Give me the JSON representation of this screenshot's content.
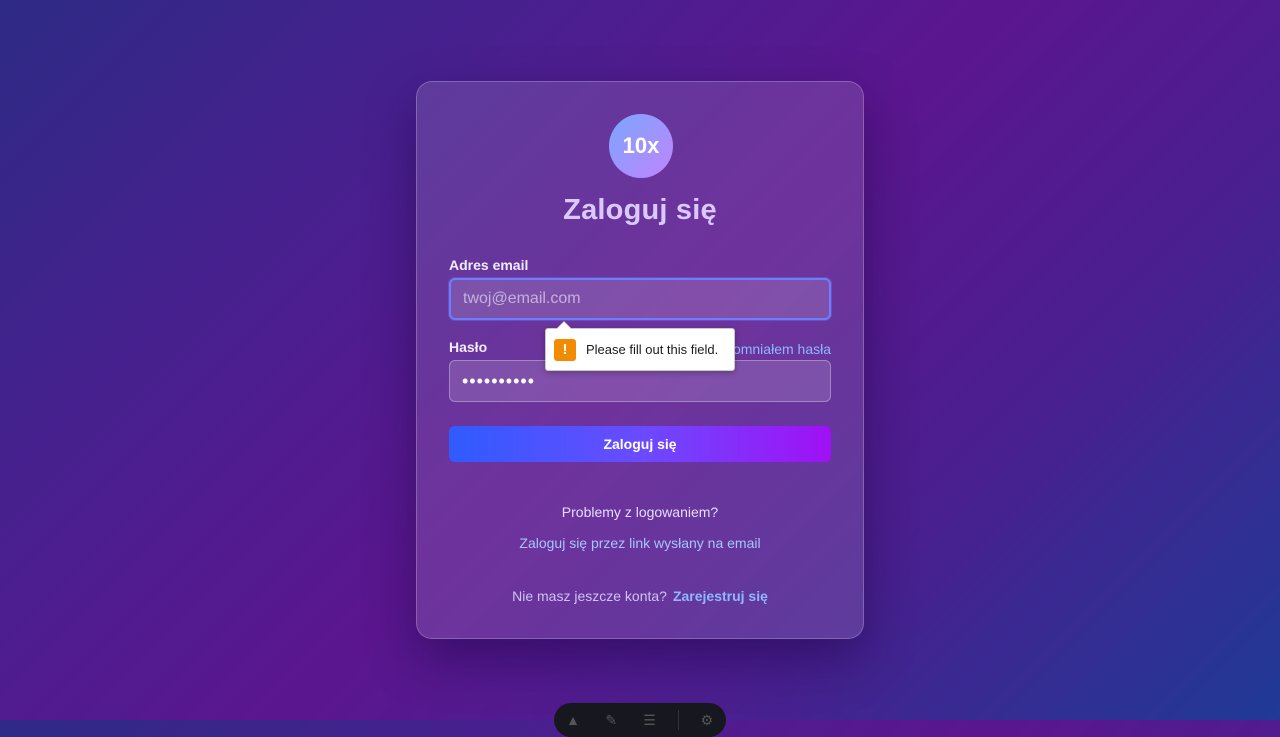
{
  "logo": {
    "text": "10x"
  },
  "heading": "Zaloguj się",
  "email": {
    "label": "Adres email",
    "placeholder": "twoj@email.com",
    "value": ""
  },
  "password": {
    "label": "Hasło",
    "value": "••••••••••",
    "forgot_link": "Zapomniałem hasła"
  },
  "submit_label": "Zaloguj się",
  "problems_text": "Problemy z logowaniem?",
  "magic_link": "Zaloguj się przez link wysłany na email",
  "register": {
    "prompt": "Nie masz jeszcze konta?",
    "link": "Zarejestruj się"
  },
  "validation_tooltip": {
    "icon": "warning-icon",
    "message": "Please fill out this field."
  },
  "devbar": {
    "icons": [
      "astro-icon",
      "audit-icon",
      "menu-icon",
      "settings-icon"
    ]
  },
  "colors": {
    "accent": "#6d7dff",
    "link": "#8db8ff",
    "warning": "#f28b00"
  }
}
